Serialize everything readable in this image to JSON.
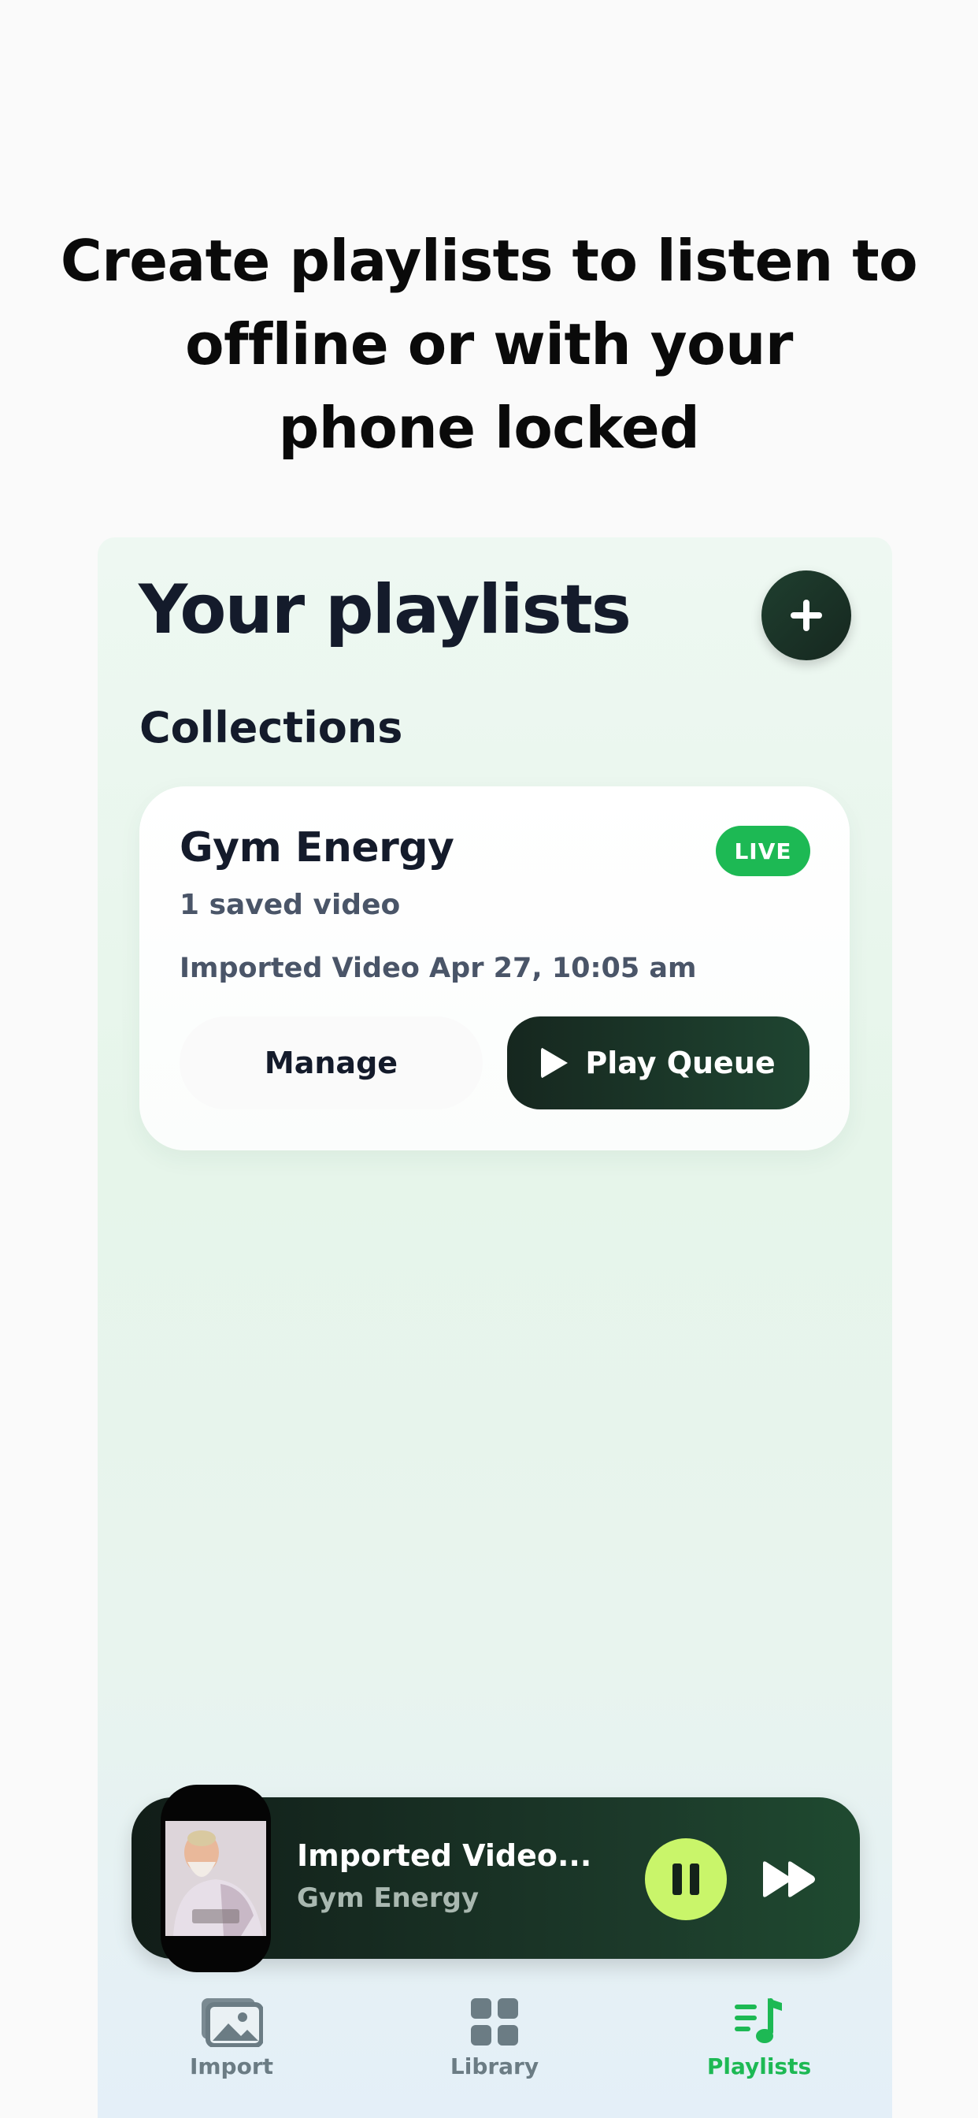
{
  "headline": {
    "line1": "Create playlists to listen to",
    "line2": "offline or with your",
    "line3": "phone locked"
  },
  "screen": {
    "title": "Your playlists",
    "add_icon": "plus-icon",
    "section_title": "Collections"
  },
  "playlist_card": {
    "title": "Gym Energy",
    "badge": "LIVE",
    "count": "1 saved video",
    "date": "Imported Video Apr 27, 10:05 am",
    "manage_label": "Manage",
    "play_label": "Play Queue"
  },
  "player": {
    "title": "Imported Video...",
    "subtitle": "Gym Energy",
    "pause_icon": "pause-icon",
    "forward_icon": "fast-forward-icon"
  },
  "tabs": [
    {
      "label": "Import",
      "icon": "photo-import-icon",
      "active": false
    },
    {
      "label": "Library",
      "icon": "grid-icon",
      "active": false
    },
    {
      "label": "Playlists",
      "icon": "music-list-icon",
      "active": true
    }
  ],
  "colors": {
    "accent_green": "#1db954",
    "player_pause": "#c9f56a",
    "dark_green": "#16271f",
    "tab_inactive": "#6b7c84",
    "tab_active": "#1db954"
  }
}
